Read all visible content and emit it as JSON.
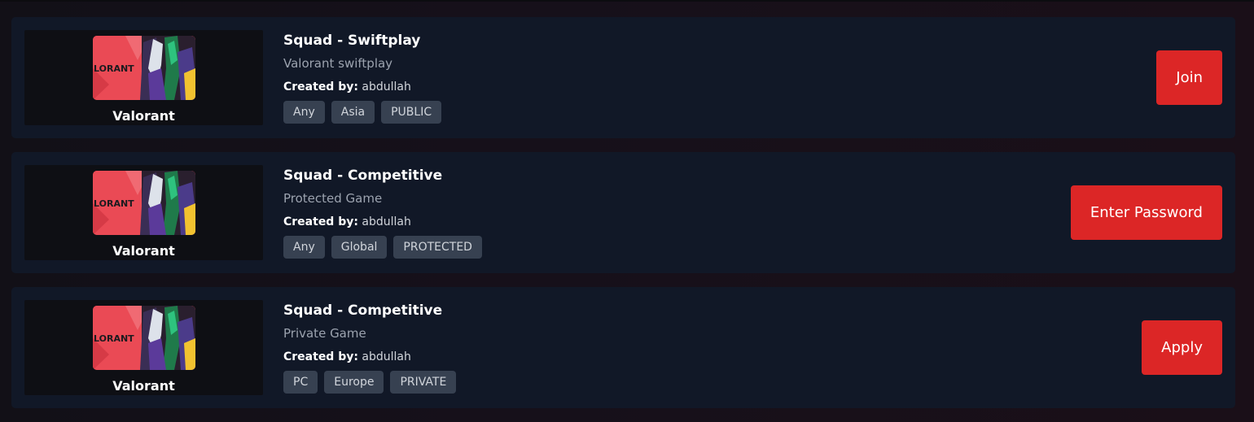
{
  "lobbies": [
    {
      "game": "Valorant",
      "art_wordmark": "LORANT",
      "title": "Squad - Swiftplay",
      "subtitle": "Valorant swiftplay",
      "created_by_label": "Created by:",
      "creator": "abdullah",
      "tags": [
        "Any",
        "Asia",
        "PUBLIC"
      ],
      "action_label": "Join"
    },
    {
      "game": "Valorant",
      "art_wordmark": "LORANT",
      "title": "Squad - Competitive",
      "subtitle": "Protected Game",
      "created_by_label": "Created by:",
      "creator": "abdullah",
      "tags": [
        "Any",
        "Global",
        "PROTECTED"
      ],
      "action_label": "Enter Password"
    },
    {
      "game": "Valorant",
      "art_wordmark": "LORANT",
      "title": "Squad - Competitive",
      "subtitle": "Private Game",
      "created_by_label": "Created by:",
      "creator": "abdullah",
      "tags": [
        "PC",
        "Europe",
        "PRIVATE"
      ],
      "action_label": "Apply"
    }
  ],
  "colors": {
    "card_bg": "#111827",
    "accent_red": "#dc2626",
    "tag_bg": "#374151",
    "art_red": "#ea4a55"
  }
}
